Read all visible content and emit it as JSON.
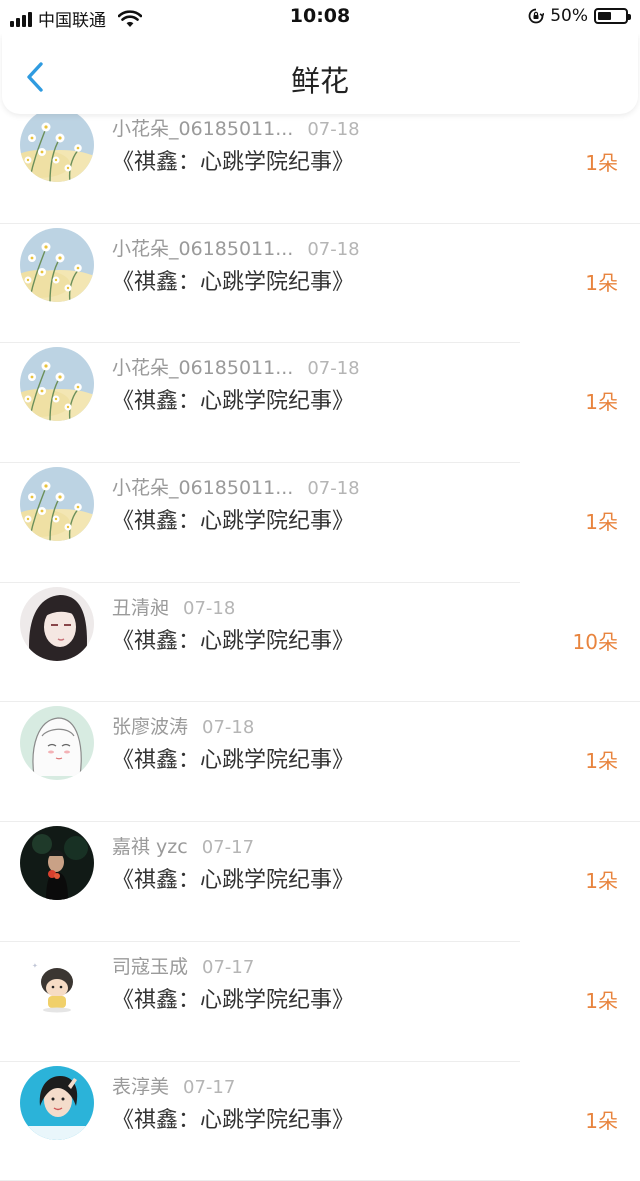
{
  "status_bar": {
    "carrier": "中国联通",
    "time": "10:08",
    "battery_text": "50%",
    "battery_level": 0.5
  },
  "nav": {
    "title": "鲜花"
  },
  "accent": "#e8843e",
  "items": [
    {
      "name": "小花朵_06185011...",
      "date": "07-18",
      "book": "《祺鑫：心跳学院纪事》",
      "quantity": "1朵",
      "avatar_icon": "daisy-avatar"
    },
    {
      "name": "小花朵_06185011...",
      "date": "07-18",
      "book": "《祺鑫：心跳学院纪事》",
      "quantity": "1朵",
      "avatar_icon": "daisy-avatar"
    },
    {
      "name": "小花朵_06185011...",
      "date": "07-18",
      "book": "《祺鑫：心跳学院纪事》",
      "quantity": "1朵",
      "avatar_icon": "daisy-avatar"
    },
    {
      "name": "小花朵_06185011...",
      "date": "07-18",
      "book": "《祺鑫：心跳学院纪事》",
      "quantity": "1朵",
      "avatar_icon": "daisy-avatar"
    },
    {
      "name": "丑清昶",
      "date": "07-18",
      "book": "《祺鑫：心跳学院纪事》",
      "quantity": "10朵",
      "avatar_icon": "anime-girl-avatar"
    },
    {
      "name": "张廖波涛",
      "date": "07-18",
      "book": "《祺鑫：心跳学院纪事》",
      "quantity": "1朵",
      "avatar_icon": "sketch-girl-avatar"
    },
    {
      "name": "嘉祺 yzc",
      "date": "07-17",
      "book": "《祺鑫：心跳学院纪事》",
      "quantity": "1朵",
      "avatar_icon": "dark-photo-avatar"
    },
    {
      "name": "司寇玉成",
      "date": "07-17",
      "book": "《祺鑫：心跳学院纪事》",
      "quantity": "1朵",
      "avatar_icon": "cartoon-boy-avatar"
    },
    {
      "name": "表淳美",
      "date": "07-17",
      "book": "《祺鑫：心跳学院纪事》",
      "quantity": "1朵",
      "avatar_icon": "photo-girl-avatar"
    }
  ]
}
